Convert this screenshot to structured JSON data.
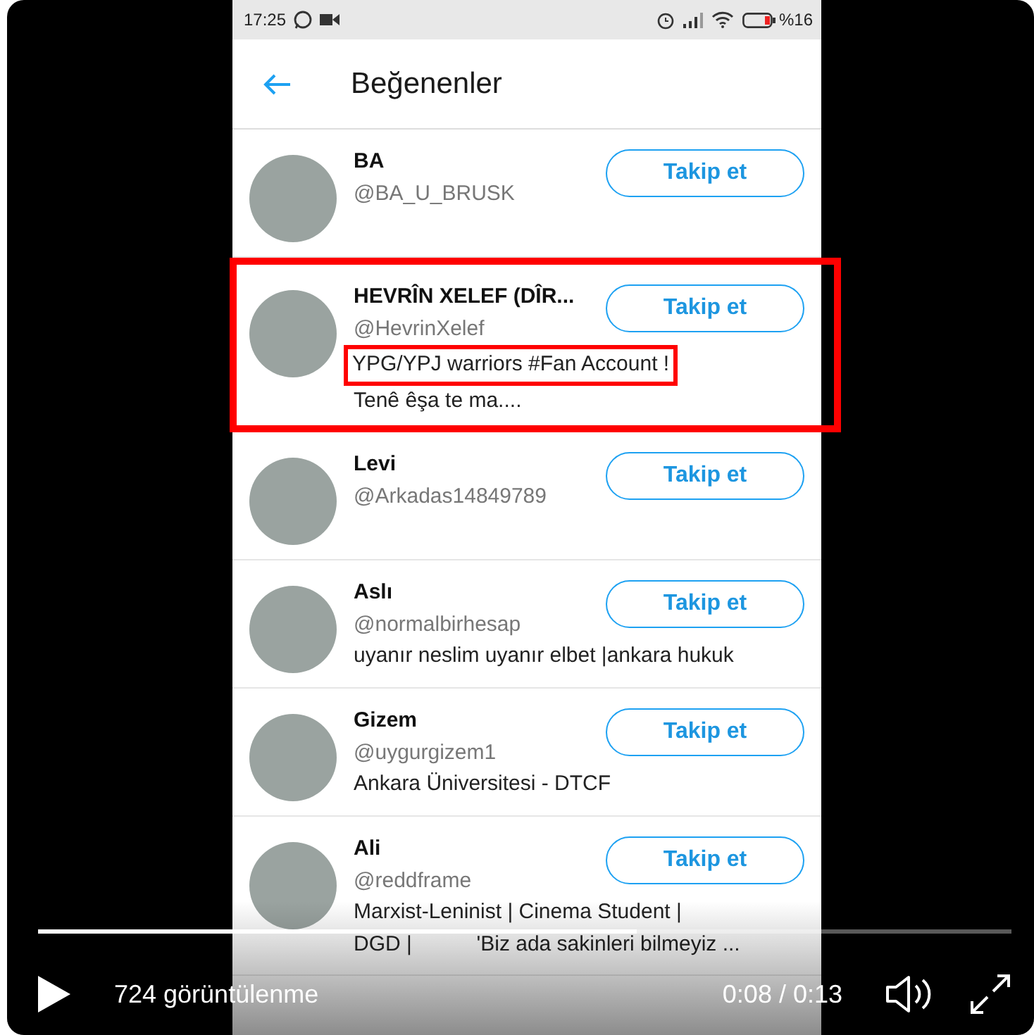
{
  "status_bar": {
    "time": "17:25",
    "battery": "%16"
  },
  "header": {
    "title": "Beğenenler"
  },
  "users": [
    {
      "name": "BA",
      "handle": "@BA_U_BRUSK",
      "button": "Takip et",
      "highlighted": false,
      "bio_highlighted": false
    },
    {
      "name": "HEVRÎN XELEF (DÎR...",
      "handle": "@HevrinXelef",
      "bio": [
        "YPG/YPJ warriors #Fan Account !",
        "Tenê êşa te ma...."
      ],
      "button": "Takip et",
      "highlighted": true,
      "bio_highlighted": true
    },
    {
      "name": "Levi",
      "handle": "@Arkadas14849789",
      "button": "Takip et",
      "highlighted": false,
      "bio_highlighted": false
    },
    {
      "name": "Aslı",
      "handle": "@normalbirhesap",
      "bio": [
        "uyanır neslim uyanır elbet |ankara hukuk"
      ],
      "button": "Takip et",
      "highlighted": false,
      "bio_highlighted": false
    },
    {
      "name": "Gizem",
      "handle": "@uygurgizem1",
      "bio": [
        "Ankara Üniversitesi - DTCF"
      ],
      "button": "Takip et",
      "highlighted": false,
      "bio_highlighted": false
    },
    {
      "name": "Ali",
      "handle": "@reddframe",
      "bio": [
        "Marxist-Leninist | Cinema Student |",
        "DGD |           'Biz ada sakinleri bilmeyiz ..."
      ],
      "button": "Takip et",
      "highlighted": false,
      "bio_highlighted": false
    }
  ],
  "player": {
    "level": 0.615,
    "views": "724 görüntülenme",
    "time": "0:08 / 0:13"
  }
}
